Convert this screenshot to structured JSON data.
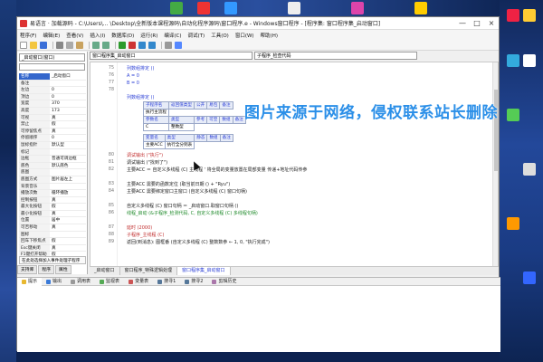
{
  "window": {
    "title": "易语言 · 加载源码 - C:\\Users\\... \\Desktop\\全新版本课程源码\\自动化程序源码\\窗口程序.e - Windows窗口程序 - [程序集: 窗口程序集_启动窗口]",
    "min_label": "—",
    "max_label": "□",
    "close_label": "×"
  },
  "menubar": {
    "items": [
      "程序(F)",
      "编辑(E)",
      "查看(V)",
      "插入(I)",
      "数据库(D)",
      "运行(R)",
      "编译(C)",
      "调试(T)",
      "工具(O)",
      "窗口(W)",
      "帮助(H)"
    ]
  },
  "left_panel": {
    "object_select": "_启动窗口(窗口)",
    "properties": [
      {
        "name": "名称",
        "value": "_启动窗口"
      },
      {
        "name": "备注",
        "value": ""
      },
      {
        "name": "左边",
        "value": "0"
      },
      {
        "name": "顶边",
        "value": "0"
      },
      {
        "name": "宽度",
        "value": "370"
      },
      {
        "name": "高度",
        "value": "173"
      },
      {
        "name": "可视",
        "value": "真"
      },
      {
        "name": "禁止",
        "value": "假"
      },
      {
        "name": "可停留焦点",
        "value": "真"
      },
      {
        "name": "停留顺序",
        "value": "0"
      },
      {
        "name": "鼠标指针",
        "value": "默认型"
      },
      {
        "name": "标记",
        "value": ""
      },
      {
        "name": "边框",
        "value": "普通可调边框"
      },
      {
        "name": "底色",
        "value": "默认底色"
      },
      {
        "name": "底图",
        "value": ""
      },
      {
        "name": "底图方式",
        "value": "图片居左上"
      },
      {
        "name": "背景音乐",
        "value": ""
      },
      {
        "name": "播放次数",
        "value": "循环播放"
      },
      {
        "name": "控制按钮",
        "value": "真"
      },
      {
        "name": "最大化按钮",
        "value": "假"
      },
      {
        "name": "最小化按钮",
        "value": "真"
      },
      {
        "name": "位置",
        "value": "居中"
      },
      {
        "name": "可否移动",
        "value": "真"
      },
      {
        "name": "图标",
        "value": ""
      },
      {
        "name": "回车下移焦点",
        "value": "假"
      },
      {
        "name": "Esc键关闭",
        "value": "真"
      },
      {
        "name": "F1键打开帮助",
        "value": "假"
      }
    ],
    "hint": "在此处选择加入事件处理子程序",
    "tabs": [
      "支持库",
      "程序",
      "属性"
    ]
  },
  "editor": {
    "object_combo": "窗口程序集_启动窗口",
    "event_combo": "子程序_检查代码",
    "lines": [
      {
        "num": "75",
        "text": "列数组排定 ()"
      },
      {
        "num": "76",
        "text": "A = 0"
      },
      {
        "num": "77",
        "text": "B = 0"
      },
      {
        "num": "78",
        "text": ""
      },
      {
        "num": "",
        "text": "列数组排定 ()"
      }
    ],
    "sub_table": {
      "headers": [
        "子程序名",
        "返回值类型",
        "公开",
        "易包",
        "备注"
      ],
      "row1": [
        "执行主流程"
      ],
      "param_headers": [
        "参数名",
        "类型",
        "参考",
        "可空",
        "数组",
        "备注"
      ],
      "param_row": [
        "C",
        "整数型"
      ],
      "local_headers": [
        "变量名",
        "类型",
        "静态",
        "数组",
        "备注"
      ],
      "local_row": [
        "主要ACC",
        "执行全分到表"
      ]
    },
    "code_lines": [
      {
        "num": "80",
        "text": "调试输出 (\"执行\")",
        "cls": "c-red"
      },
      {
        "num": "81",
        "text": "调试输出 (\"找到了\")",
        "cls": ""
      },
      {
        "num": "82",
        "text": "主要ACC ＝ 自定义多线程 (C) 主线程   ' 将全局的变量放置在局部变量 传递+地址代码传参",
        "cls": ""
      },
      {
        "num": "",
        "text": "",
        "cls": ""
      },
      {
        "num": "83",
        "text": "主要ACC 需要的函数定位 (取当前日期 () + \"Ryu\")",
        "cls": ""
      },
      {
        "num": "84",
        "text": "主要ACC 需要绑定窗口主窗口 (自定义多线程 (C) 窗口句柄)",
        "cls": ""
      },
      {
        "num": "",
        "text": "",
        "cls": ""
      },
      {
        "num": "85",
        "text": "自定义多线程 (C) 窗口句柄 ＝ _启动窗口.取窗口句柄 ()",
        "cls": ""
      },
      {
        "num": "86",
        "text": "  线程_启动 (&子程序_检测代码, C, 自定义多线程 (C) 多线程句柄)",
        "cls": "c-green"
      },
      {
        "num": "",
        "text": "",
        "cls": ""
      },
      {
        "num": "87",
        "text": "延时 (2000)",
        "cls": "c-red"
      },
      {
        "num": "88",
        "text": "子程序_主线程 (C)",
        "cls": "c-red"
      },
      {
        "num": "89",
        "text": "返回(到消息): 图框番 (自定义多线程 (C) 整数数参 ← 1, 0, \"执行完成\")",
        "cls": ""
      }
    ],
    "tabs": [
      "_启动窗口",
      "窗口程序_特殊逻辑处理",
      "窗口程序集_启动窗口"
    ],
    "active_tab": 2
  },
  "watermark": "图片来源于网络，侵权联系站长删除",
  "bottom_tabs": [
    "提示",
    "输出",
    "调用表",
    "监视表",
    "变量表",
    "搜寻1",
    "搜寻2",
    "剪辑历史"
  ],
  "bottom_active": 0,
  "colors": {
    "accent": "#2b3fd6",
    "watermark": "#2b8fe8",
    "selected": "#3366cc"
  }
}
